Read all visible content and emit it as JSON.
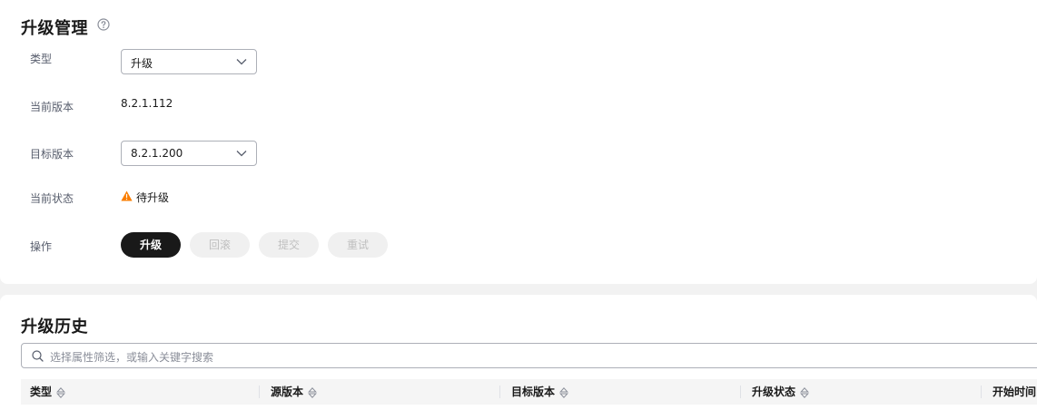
{
  "upgrade": {
    "title": "升级管理",
    "type_label": "类型",
    "type_value": "升级",
    "current_version_label": "当前版本",
    "current_version_value": "8.2.1.112",
    "target_version_label": "目标版本",
    "target_version_value": "8.2.1.200",
    "status_label": "当前状态",
    "status_value": "待升级",
    "action_label": "操作",
    "buttons": [
      "升级",
      "回滚",
      "提交",
      "重试"
    ]
  },
  "history": {
    "title": "升级历史",
    "search_placeholder": "选择属性筛选，或输入关键字搜索",
    "columns": [
      "类型",
      "源版本",
      "目标版本",
      "升级状态",
      "开始时间"
    ]
  },
  "colors": {
    "primary_button": "#191919",
    "warning": "#fa7d00"
  }
}
